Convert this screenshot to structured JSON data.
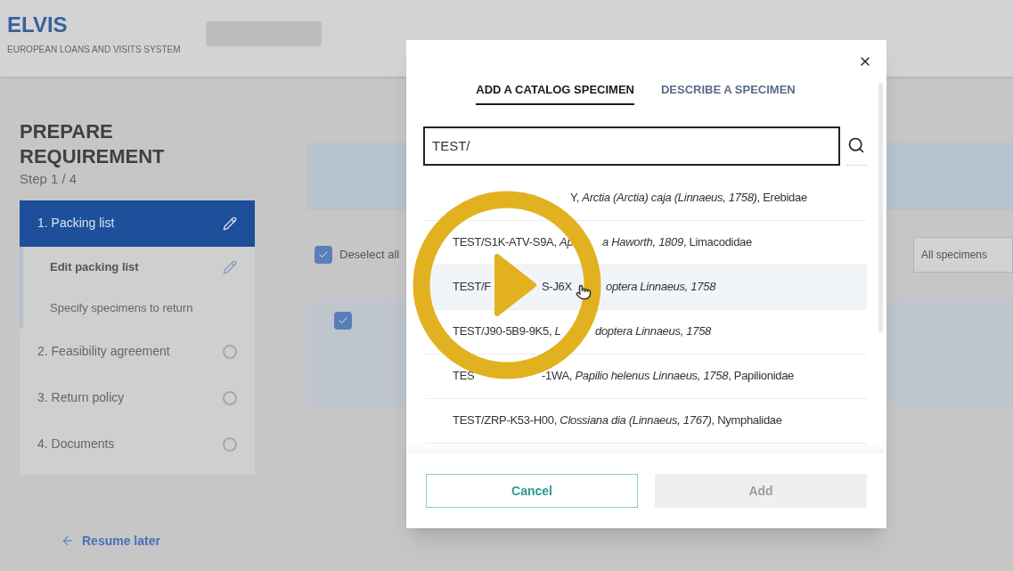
{
  "header": {
    "logo": "ELVIS",
    "subtitle": "EUROPEAN LOANS AND VISITS SYSTEM"
  },
  "sidebar": {
    "title": "PREPARE REQUIREMENT",
    "step": "Step 1 / 4",
    "steps": [
      {
        "label": "1. Packing list",
        "selected": true,
        "children": [
          {
            "label": "Edit packing list",
            "selected": true
          },
          {
            "label": "Specify specimens to return",
            "selected": false
          }
        ]
      },
      {
        "label": "2. Feasibility agreement",
        "selected": false
      },
      {
        "label": "3. Return policy",
        "selected": false
      },
      {
        "label": "4. Documents",
        "selected": false
      }
    ],
    "resume_link": "Resume later"
  },
  "content": {
    "deselect_all": {
      "label": "Deselect all",
      "checked": true
    },
    "filter": "All specimens",
    "card": {
      "checked": true
    }
  },
  "dialog": {
    "tabs": [
      {
        "label": "ADD A CATALOG SPECIMEN",
        "selected": true
      },
      {
        "label": "DESCRIBE A SPECIMEN",
        "selected": false
      }
    ],
    "search": {
      "value": "TEST/"
    },
    "results": [
      {
        "highlighted": false,
        "parts": [
          "Y, *Arctia (Arctia) caja (Linnaeus, 1758)*, Erebidae"
        ]
      },
      {
        "highlighted": false,
        "parts": [
          "TEST/S1K-ATV-S9A, *Ap*",
          "*a Haworth, 1809*, Limacodidae"
        ]
      },
      {
        "highlighted": true,
        "parts": [
          "TEST/F",
          "S-J6X",
          "*optera Linnaeus, 1758*"
        ]
      },
      {
        "highlighted": false,
        "parts": [
          "TEST/J90-5B9-9K5, *L*",
          "*doptera Linnaeus, 1758*"
        ]
      },
      {
        "highlighted": false,
        "parts": [
          "TES",
          "-1WA, *Papilio helenus Linnaeus, 1758*, Papilionidae"
        ]
      },
      {
        "highlighted": false,
        "parts": [
          "TEST/ZRP-K53-H00, *Clossiana dia (Linnaeus, 1767)*, Nymphalidae"
        ]
      }
    ],
    "buttons": [
      {
        "label": "Cancel",
        "kind": "secondary"
      },
      {
        "label": "Add",
        "kind": "primary",
        "disabled": true
      }
    ]
  }
}
